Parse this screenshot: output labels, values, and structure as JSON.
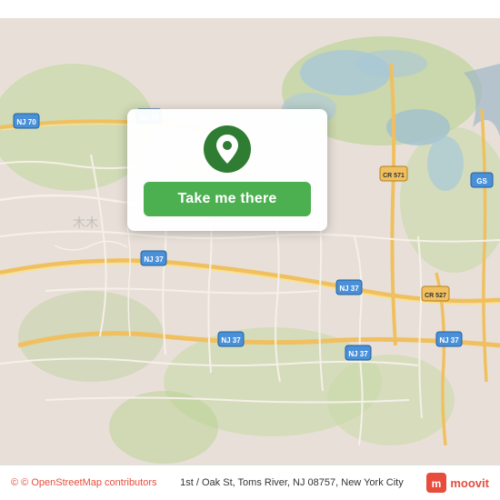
{
  "map": {
    "center_lat": 39.98,
    "center_lng": -74.18,
    "zoom": 12
  },
  "card": {
    "button_label": "Take me there",
    "pin_color": "#2e7d32"
  },
  "bottom_bar": {
    "osm_credit": "© OpenStreetMap contributors",
    "address": "1st / Oak St, Toms River, NJ 08757, New York City",
    "moovit_label": "moovit"
  }
}
